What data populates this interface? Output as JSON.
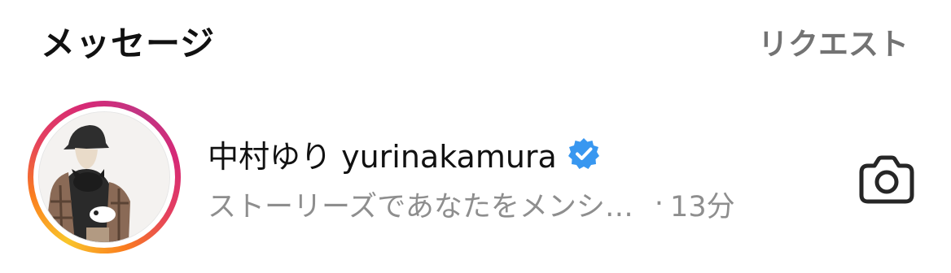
{
  "header": {
    "title": "メッセージ",
    "request_label": "リクエスト"
  },
  "thread": {
    "display_name": "中村ゆり",
    "username": "yurinakamura",
    "name_line": "中村ゆり yurinakamura",
    "verified": true,
    "preview_text": "ストーリーズであなたをメンシ…",
    "separator": "·",
    "time_ago": "13分",
    "story_ring_colors": [
      "#f9c52b",
      "#fa7e1e",
      "#e4405f",
      "#d62976",
      "#c13584"
    ],
    "verified_color": "#3897f0"
  },
  "icons": {
    "verified": "verified-badge-icon",
    "camera": "camera-icon"
  }
}
